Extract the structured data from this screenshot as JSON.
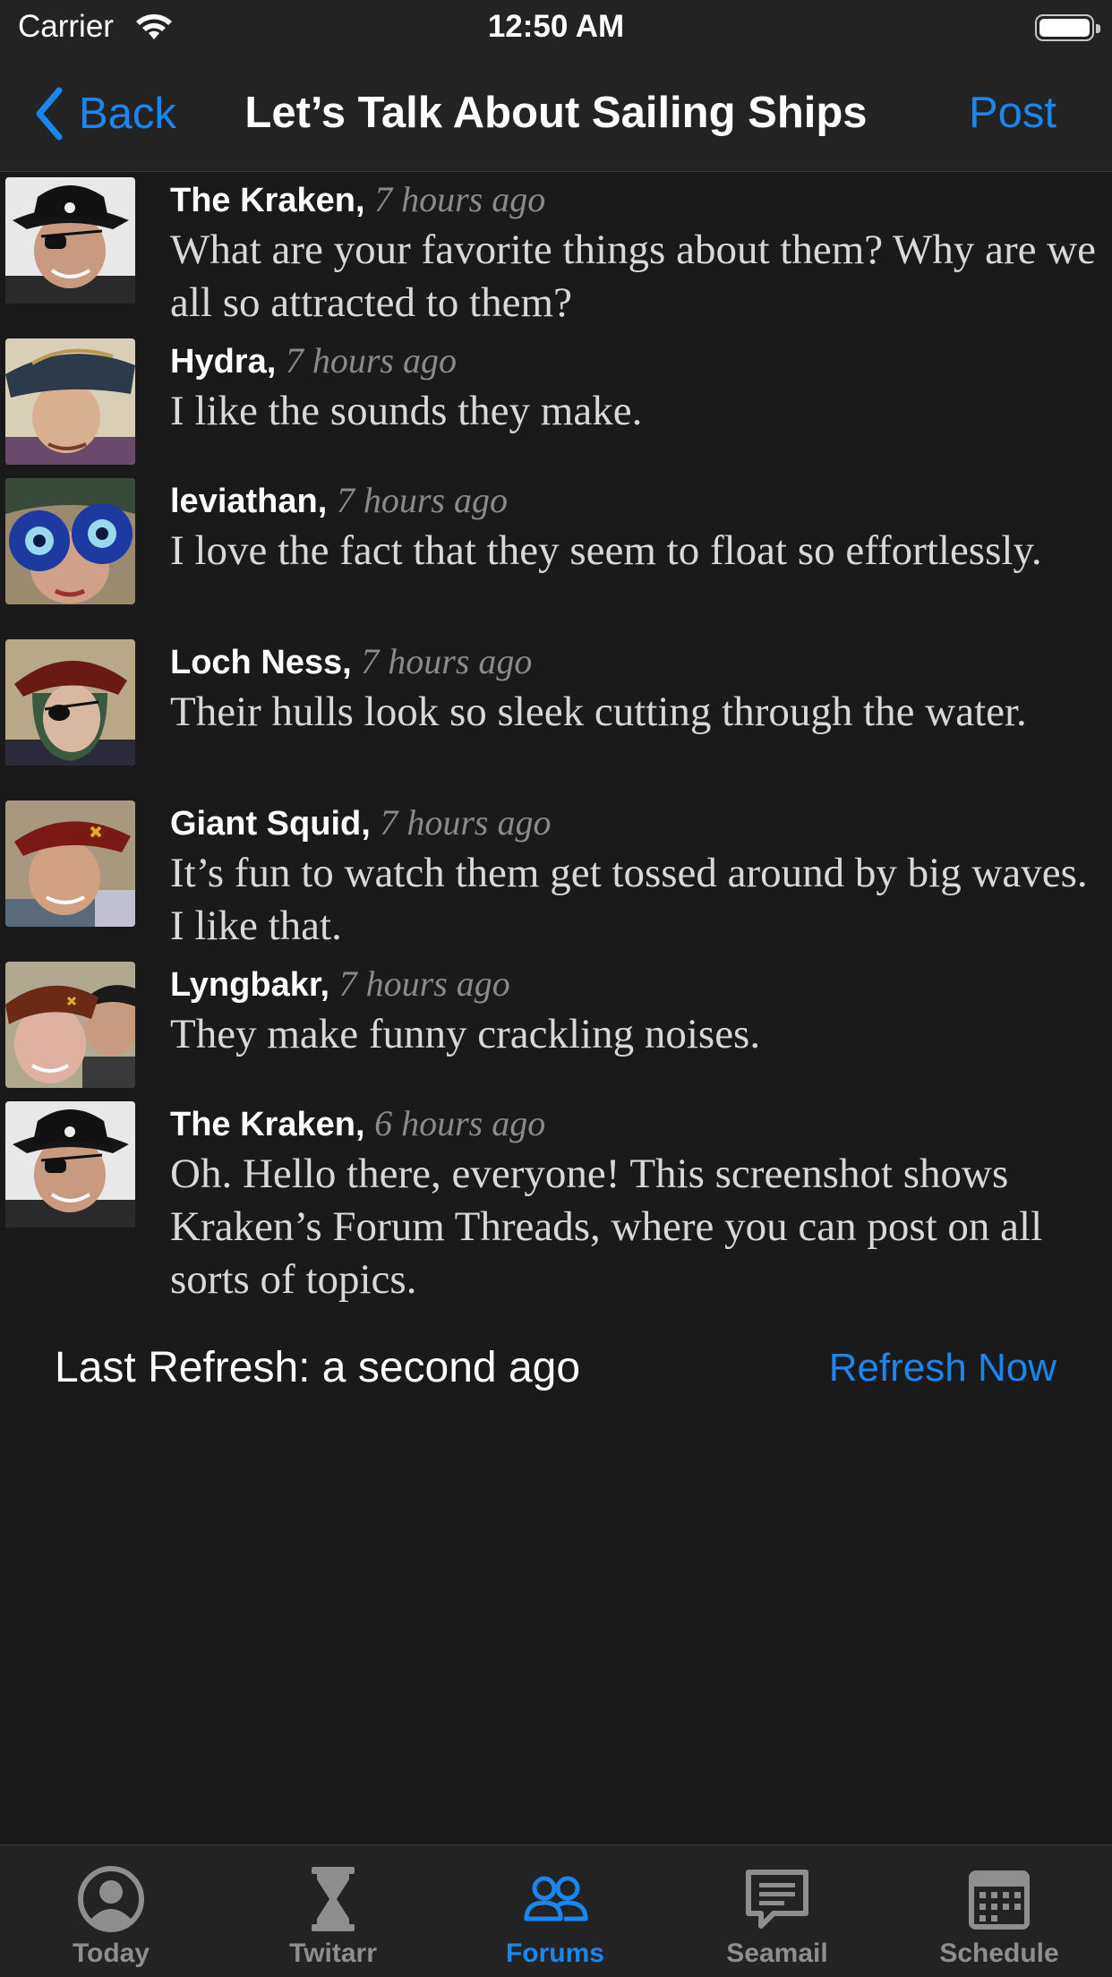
{
  "status_bar": {
    "carrier": "Carrier",
    "time": "12:50 AM"
  },
  "nav": {
    "back_label": "Back",
    "title": "Let’s Talk About Sailing Ships",
    "post_label": "Post"
  },
  "posts": [
    {
      "author": "The Kraken,",
      "time": "7 hours ago",
      "text": "What are your favorite things about them? Why are we all so attracted to them?"
    },
    {
      "author": "Hydra,",
      "time": "7 hours ago",
      "text": "I like the sounds they make."
    },
    {
      "author": "leviathan,",
      "time": "7 hours ago",
      "text": "I love the fact that they seem to float so effortlessly."
    },
    {
      "author": "Loch Ness,",
      "time": "7 hours ago",
      "text": "Their hulls look so sleek cutting through the water."
    },
    {
      "author": "Giant Squid,",
      "time": "7 hours ago",
      "text": "It’s fun to watch them get tossed around by big waves. I like that."
    },
    {
      "author": "Lyngbakr,",
      "time": "7 hours ago",
      "text": "They make funny crackling noises."
    },
    {
      "author": "The Kraken,",
      "time": "6 hours ago",
      "text": "Oh. Hello there, everyone! This screenshot shows Kraken’s Forum Threads, where you can post on all sorts of topics."
    }
  ],
  "refresh": {
    "last_refresh": "Last Refresh: a second ago",
    "refresh_now": "Refresh Now"
  },
  "tabs": [
    {
      "label": "Today",
      "icon": "person-circle-icon",
      "active": false
    },
    {
      "label": "Twitarr",
      "icon": "hourglass-icon",
      "active": false
    },
    {
      "label": "Forums",
      "icon": "people-icon",
      "active": true
    },
    {
      "label": "Seamail",
      "icon": "message-bubble-icon",
      "active": false
    },
    {
      "label": "Schedule",
      "icon": "calendar-icon",
      "active": false
    }
  ],
  "colors": {
    "accent": "#1a86f0",
    "background": "#1a1a1a",
    "bar": "#232323"
  }
}
